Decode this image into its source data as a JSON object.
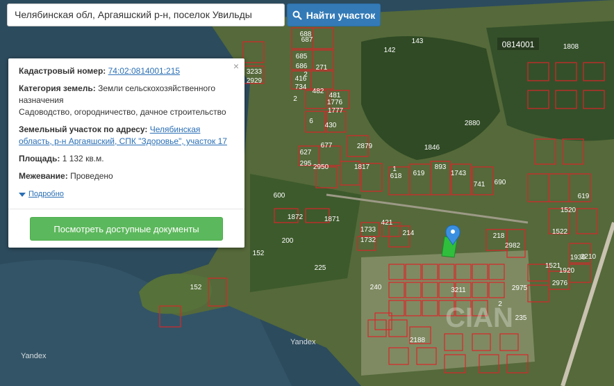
{
  "search": {
    "value": "Челябинская обл, Аргаяшский р-н, поселок Увильды",
    "button_label": "Найти участок"
  },
  "popup": {
    "cadastral_label": "Кадастровый номер:",
    "cadastral_value": "74:02:0814001:215",
    "category_label": "Категория земель:",
    "category_value": "Земли сельскохозяйственного назначения",
    "usage_value": "Садоводство, огородничество, дачное строительство",
    "address_label": "Земельный участок по адресу:",
    "address_value": "Челябинская область, р-н Аргаяшский, СПК \"Здоровье\", участок 17",
    "area_label": "Площадь:",
    "area_value": "1 132 кв.м.",
    "survey_label": "Межевание:",
    "survey_value": "Проведено",
    "more_link": "Подробно",
    "docs_button": "Посмотреть доступные документы",
    "close_glyph": "×"
  },
  "map": {
    "quarter_label": "0814001",
    "watermarks": [
      "Yandex",
      "Yandex"
    ],
    "plot_labels": [
      "688",
      "271",
      "685",
      "686",
      "2",
      "416",
      "2",
      "734",
      "481",
      "482",
      "1776",
      "1777",
      "430",
      "6",
      "2879",
      "627",
      "677",
      "295",
      "2950",
      "1817",
      "1",
      "618",
      "619",
      "893",
      "1743",
      "741",
      "690",
      "600",
      "1872",
      "1871",
      "1733",
      "421",
      "214",
      "1732",
      "218",
      "2982",
      "152",
      "200",
      "225",
      "152",
      "240",
      "2975",
      "2976",
      "2188",
      "3233",
      "2929",
      "143",
      "142",
      "687",
      "2880",
      "1846",
      "1808",
      "619",
      "1520",
      "1522",
      "1521",
      "1920",
      "1930",
      "3210",
      "3211",
      "2",
      "235"
    ],
    "building_label": "CIAN"
  },
  "colors": {
    "parcel_outline": "#d9262b",
    "search_button": "#337ab7",
    "docs_button": "#5cb85c",
    "selected_parcel": "#2fbf3d",
    "marker": "#3b8fe0"
  }
}
